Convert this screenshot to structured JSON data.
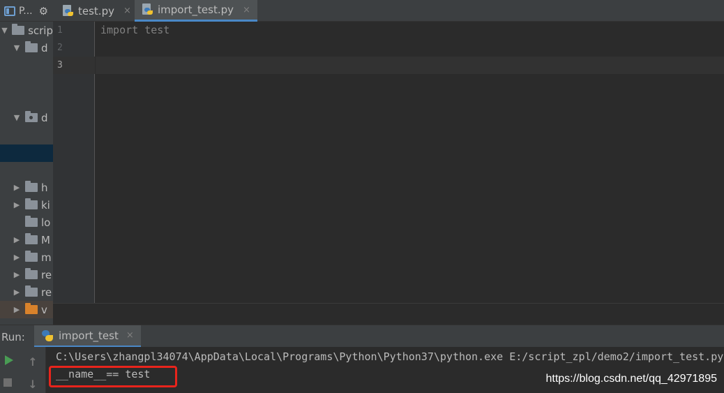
{
  "project_panel": {
    "title": "P...",
    "gear_icon": "gear-icon"
  },
  "tabs": [
    {
      "label": "test.py",
      "close": "×",
      "icon": "python-file-icon"
    },
    {
      "label": "import_test.py",
      "close": "×",
      "icon": "python-file-icon"
    }
  ],
  "tree": [
    {
      "label": "scrip",
      "arrow": "▼"
    },
    {
      "label": "d",
      "arrow": "▼"
    },
    {
      "label": "d",
      "arrow": "▼"
    },
    {
      "label": "h",
      "arrow": "▶"
    },
    {
      "label": "ki",
      "arrow": "▶"
    },
    {
      "label": "lo",
      "arrow": ""
    },
    {
      "label": "M",
      "arrow": "▶"
    },
    {
      "label": "m",
      "arrow": "▶"
    },
    {
      "label": "re",
      "arrow": "▶"
    },
    {
      "label": "re",
      "arrow": "▶"
    },
    {
      "label": "v",
      "arrow": "▶"
    }
  ],
  "editor": {
    "line_numbers": [
      "1",
      "2",
      "3"
    ],
    "lines": [
      "import test",
      "",
      ""
    ]
  },
  "run": {
    "label": "Run:",
    "tab_label": "import_test",
    "tab_close": "×",
    "up_arrow": "↑",
    "down_arrow": "↓",
    "command": "C:\\Users\\zhangpl34074\\AppData\\Local\\Programs\\Python\\Python37\\python.exe E:/script_zpl/demo2/import_test.py",
    "output": "__name__== test"
  },
  "watermark": "https://blog.csdn.net/qq_42971895"
}
